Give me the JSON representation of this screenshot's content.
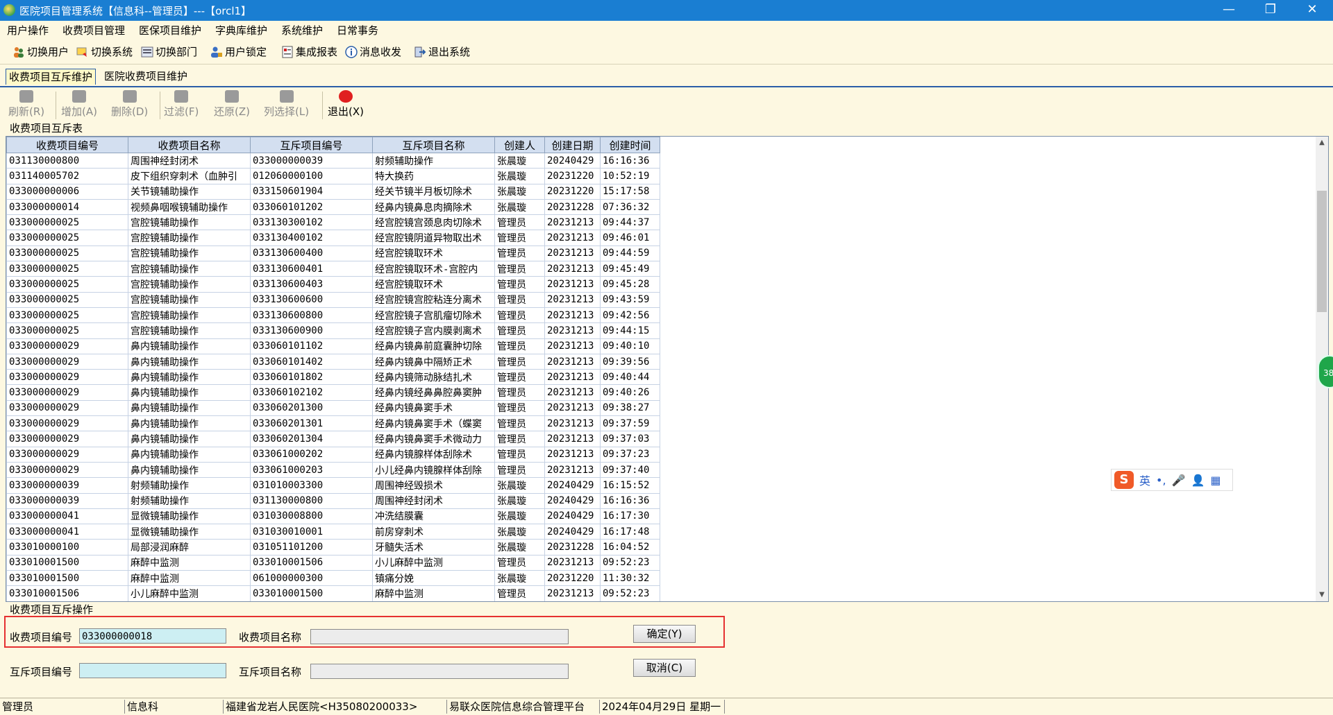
{
  "window": {
    "title": "医院项目管理系统【信息科--管理员】---【orcl1】",
    "minimize": "—",
    "restore": "❐",
    "close": "✕"
  },
  "menubar": [
    "用户操作",
    "收费项目管理",
    "医保项目维护",
    "字典库维护",
    "系统维护",
    "日常事务"
  ],
  "toolbar": [
    "切换用户",
    "切换系统",
    "切换部门",
    "用户锁定",
    "集成报表",
    "消息收发",
    "退出系统"
  ],
  "tabs": [
    "收费项目互斥维护",
    "医院收费项目维护"
  ],
  "actions": {
    "refresh": "刷新(R)",
    "add": "增加(A)",
    "delete": "删除(D)",
    "filter": "过滤(F)",
    "restore": "还原(Z)",
    "columns": "列选择(L)",
    "exit": "退出(X)"
  },
  "grid": {
    "group_title": "收费项目互斥表",
    "columns": [
      "收费项目编号",
      "收费项目名称",
      "互斥项目编号",
      "互斥项目名称",
      "创建人",
      "创建日期",
      "创建时间"
    ],
    "rows": [
      [
        "031130000800",
        "周围神经封闭术",
        "033000000039",
        "射频辅助操作",
        "张晨璇",
        "20240429",
        "16:16:36"
      ],
      [
        "031140005702",
        "皮下组织穿刺术（血肿引",
        "012060000100",
        "特大换药",
        "张晨璇",
        "20231220",
        "10:52:19"
      ],
      [
        "033000000006",
        "关节镜辅助操作",
        "033150601904",
        "经关节镜半月板切除术",
        "张晨璇",
        "20231220",
        "15:17:58"
      ],
      [
        "033000000014",
        "视频鼻咽喉镜辅助操作",
        "033060101202",
        "经鼻内镜鼻息肉摘除术",
        "张晨璇",
        "20231228",
        "07:36:32"
      ],
      [
        "033000000025",
        "宫腔镜辅助操作",
        "033130300102",
        "经宫腔镜宫颈息肉切除术",
        "管理员",
        "20231213",
        "09:44:37"
      ],
      [
        "033000000025",
        "宫腔镜辅助操作",
        "033130400102",
        "经宫腔镜阴道异物取出术",
        "管理员",
        "20231213",
        "09:46:01"
      ],
      [
        "033000000025",
        "宫腔镜辅助操作",
        "033130600400",
        "经宫腔镜取环术",
        "管理员",
        "20231213",
        "09:44:59"
      ],
      [
        "033000000025",
        "宫腔镜辅助操作",
        "033130600401",
        "经宫腔镜取环术-宫腔内",
        "管理员",
        "20231213",
        "09:45:49"
      ],
      [
        "033000000025",
        "宫腔镜辅助操作",
        "033130600403",
        "经宫腔镜取环术",
        "管理员",
        "20231213",
        "09:45:28"
      ],
      [
        "033000000025",
        "宫腔镜辅助操作",
        "033130600600",
        "经宫腔镜宫腔粘连分离术",
        "管理员",
        "20231213",
        "09:43:59"
      ],
      [
        "033000000025",
        "宫腔镜辅助操作",
        "033130600800",
        "经宫腔镜子宫肌瘤切除术",
        "管理员",
        "20231213",
        "09:42:56"
      ],
      [
        "033000000025",
        "宫腔镜辅助操作",
        "033130600900",
        "经宫腔镜子宫内膜剥离术",
        "管理员",
        "20231213",
        "09:44:15"
      ],
      [
        "033000000029",
        "鼻内镜辅助操作",
        "033060101102",
        "经鼻内镜鼻前庭囊肿切除",
        "管理员",
        "20231213",
        "09:40:10"
      ],
      [
        "033000000029",
        "鼻内镜辅助操作",
        "033060101402",
        "经鼻内镜鼻中隔矫正术",
        "管理员",
        "20231213",
        "09:39:56"
      ],
      [
        "033000000029",
        "鼻内镜辅助操作",
        "033060101802",
        "经鼻内镜筛动脉结扎术",
        "管理员",
        "20231213",
        "09:40:44"
      ],
      [
        "033000000029",
        "鼻内镜辅助操作",
        "033060102102",
        "经鼻内镜经鼻鼻腔鼻窦肿",
        "管理员",
        "20231213",
        "09:40:26"
      ],
      [
        "033000000029",
        "鼻内镜辅助操作",
        "033060201300",
        "经鼻内镜鼻窦手术",
        "管理员",
        "20231213",
        "09:38:27"
      ],
      [
        "033000000029",
        "鼻内镜辅助操作",
        "033060201301",
        "经鼻内镜鼻窦手术（蝶窦",
        "管理员",
        "20231213",
        "09:37:59"
      ],
      [
        "033000000029",
        "鼻内镜辅助操作",
        "033060201304",
        "经鼻内镜鼻窦手术微动力",
        "管理员",
        "20231213",
        "09:37:03"
      ],
      [
        "033000000029",
        "鼻内镜辅助操作",
        "033061000202",
        "经鼻内镜腺样体刮除术",
        "管理员",
        "20231213",
        "09:37:23"
      ],
      [
        "033000000029",
        "鼻内镜辅助操作",
        "033061000203",
        "小儿经鼻内镜腺样体刮除",
        "管理员",
        "20231213",
        "09:37:40"
      ],
      [
        "033000000039",
        "射频辅助操作",
        "031010003300",
        "周围神经毁损术",
        "张晨璇",
        "20240429",
        "16:15:52"
      ],
      [
        "033000000039",
        "射频辅助操作",
        "031130000800",
        "周围神经封闭术",
        "张晨璇",
        "20240429",
        "16:16:36"
      ],
      [
        "033000000041",
        "显微镜辅助操作",
        "031030008800",
        "冲洗结膜囊",
        "张晨璇",
        "20240429",
        "16:17:30"
      ],
      [
        "033000000041",
        "显微镜辅助操作",
        "031030010001",
        "前房穿刺术",
        "张晨璇",
        "20240429",
        "16:17:48"
      ],
      [
        "033010000100",
        "局部浸润麻醉",
        "031051101200",
        "牙髓失活术",
        "张晨璇",
        "20231228",
        "16:04:52"
      ],
      [
        "033010001500",
        "麻醉中监测",
        "033010001506",
        "小儿麻醉中监测",
        "管理员",
        "20231213",
        "09:52:23"
      ],
      [
        "033010001500",
        "麻醉中监测",
        "061000000300",
        "镇痛分娩",
        "张晨璇",
        "20231220",
        "11:30:32"
      ],
      [
        "033010001506",
        "小儿麻醉中监测",
        "033010001500",
        "麻醉中监测",
        "管理员",
        "20231213",
        "09:52:23"
      ]
    ]
  },
  "ops": {
    "group_title": "收费项目互斥操作",
    "item_code_label": "收费项目编号",
    "item_code_value": "033000000018",
    "item_name_label": "收费项目名称",
    "item_name_value": "",
    "mutex_code_label": "互斥项目编号",
    "mutex_code_value": "",
    "mutex_name_label": "互斥项目名称",
    "mutex_name_value": "",
    "ok_button": "确定(Y)",
    "cancel_button": "取消(C)"
  },
  "ime": {
    "logo": "S",
    "mode": "英"
  },
  "float_badge": "38",
  "status": [
    "管理员",
    "信息科",
    "福建省龙岩人民医院<H35080200033>",
    "易联众医院信息综合管理平台",
    "2024年04月29日 星期一"
  ]
}
